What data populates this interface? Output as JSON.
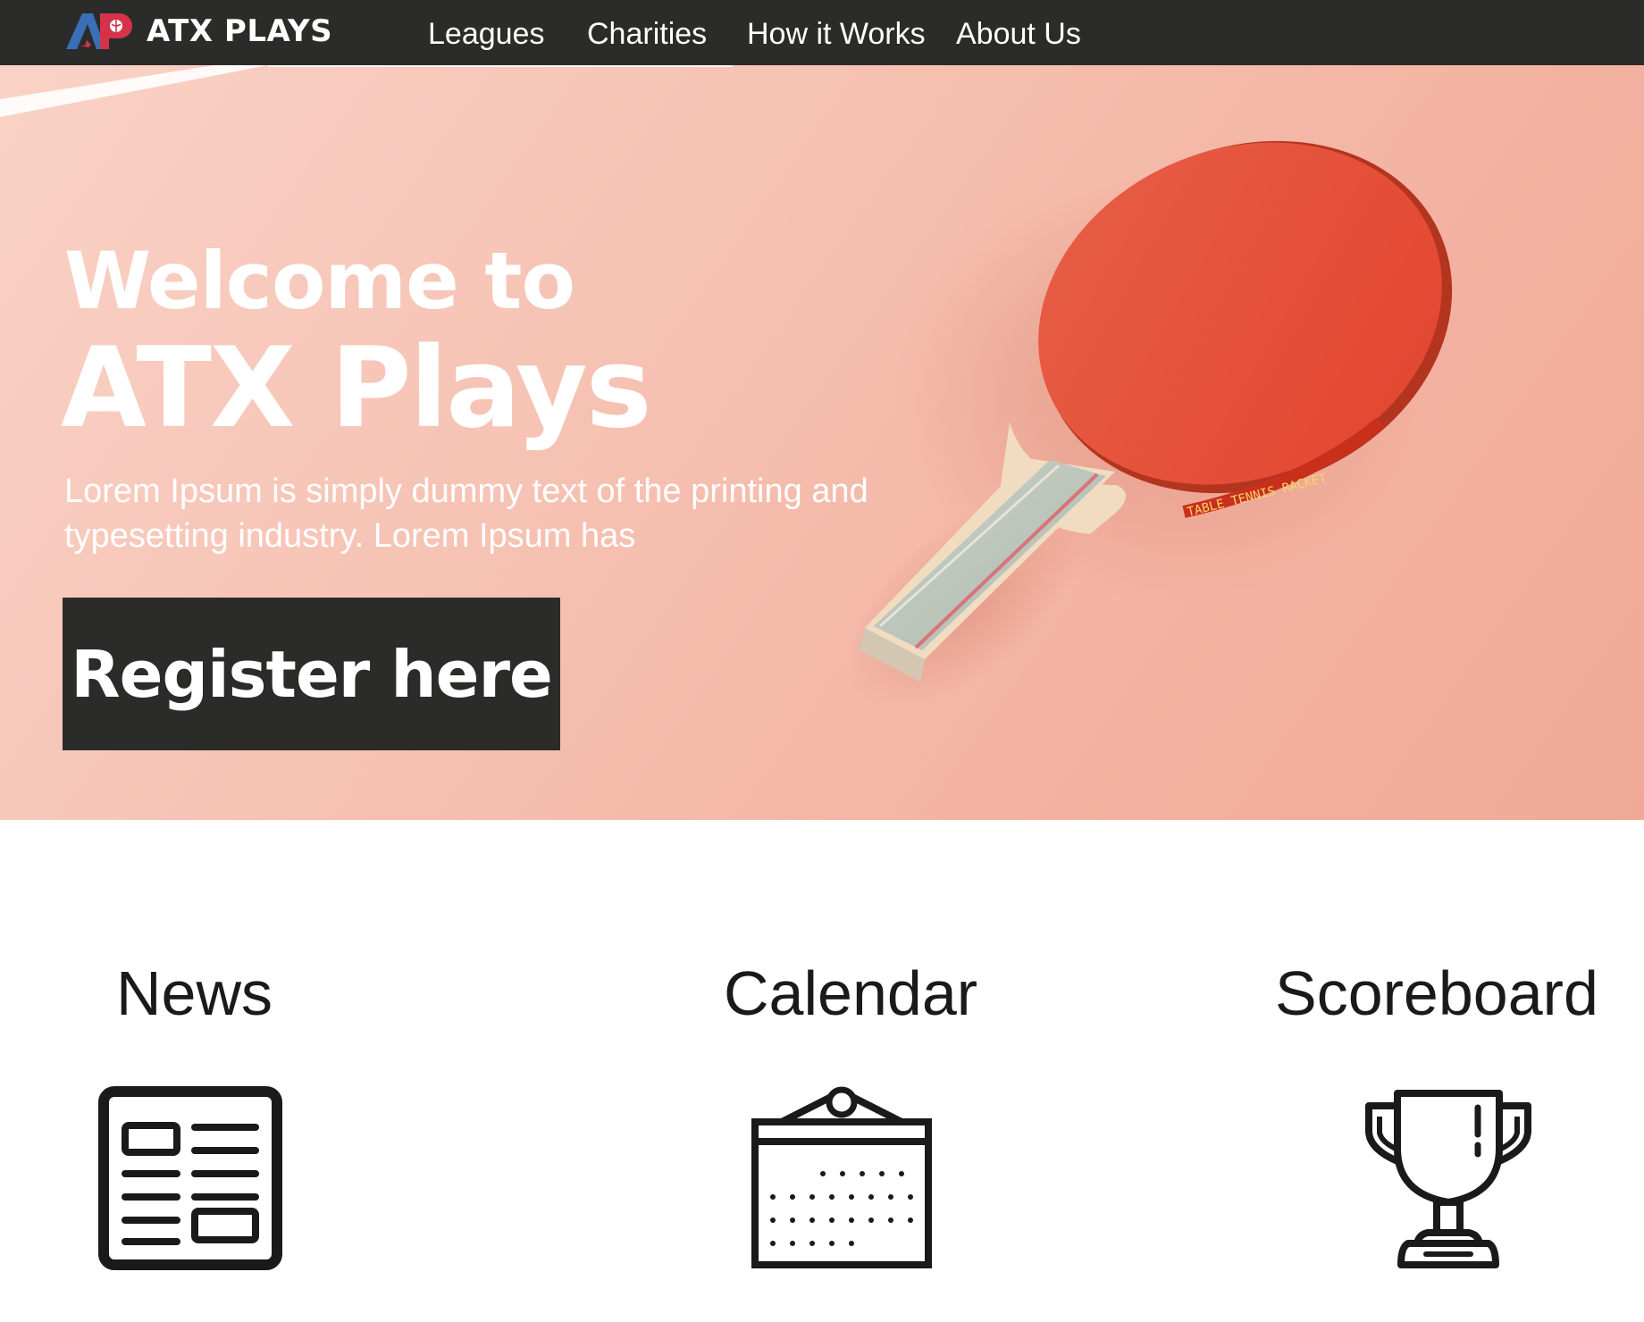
{
  "nav": {
    "logo_text": "AP",
    "brand": "ATX PLAYS",
    "links": [
      "Leagues",
      "Charities",
      "How it Works",
      "About Us"
    ]
  },
  "hero": {
    "title_line1": "Welcome to",
    "title_line2": "ATX Plays",
    "text": "Lorem Ipsum is simply dummy text of the printing and typesetting industry. Lorem Ipsum has",
    "cta_label": "Register here",
    "paddle_text": "TABLE TENNIS RACKET"
  },
  "features": [
    {
      "title": "News",
      "icon": "newspaper-icon"
    },
    {
      "title": "Calendar",
      "icon": "calendar-icon"
    },
    {
      "title": "Scoreboard",
      "icon": "trophy-icon"
    }
  ],
  "colors": {
    "nav_bg": "#2b2b29",
    "hero_bg": "#f6c2b3",
    "paddle_red": "#e8503c",
    "logo_blue": "#3a6fb7",
    "logo_red": "#d5334a"
  }
}
